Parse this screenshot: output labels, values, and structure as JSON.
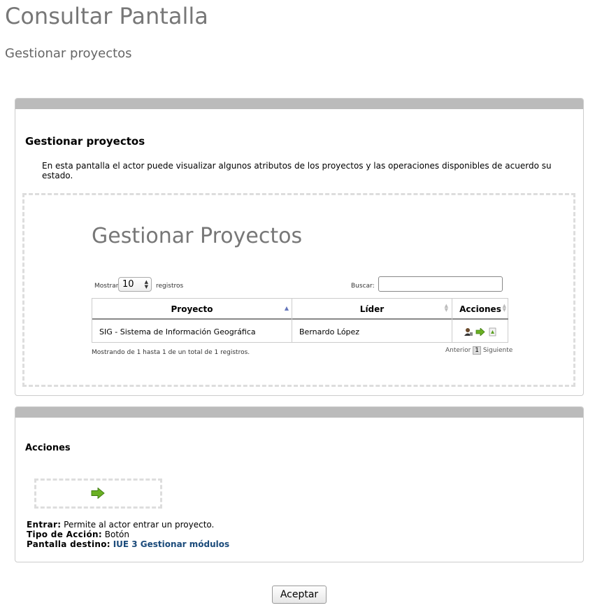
{
  "header": {
    "title": "Consultar Pantalla",
    "subtitle": "Gestionar proyectos"
  },
  "panel1": {
    "title": "Gestionar proyectos",
    "description": "En esta pantalla el actor puede visualizar algunos atributos de los proyectos y las operaciones disponibles de acuerdo su estado.",
    "screen": {
      "title": "Gestionar Proyectos",
      "length_prefix": "Mostrar",
      "length_value": "10",
      "length_suffix": "registros",
      "search_label": "Buscar:",
      "search_value": "",
      "columns": [
        "Proyecto",
        "Líder",
        "Acciones"
      ],
      "rows": [
        {
          "proyecto": "SIG - Sistema de Información Geográfica",
          "lider": "Bernardo López",
          "actions": [
            "user-icon",
            "arrow-right-icon",
            "document-icon"
          ]
        }
      ],
      "info": "Mostrando de 1 hasta 1 de un total de 1 registros.",
      "pagination": {
        "prev": "Anterior",
        "current": "1",
        "next": "Siguiente"
      }
    }
  },
  "panel2": {
    "title": "Acciones",
    "action_icon": "arrow-right-icon",
    "entrar_label": "Entrar:",
    "entrar_text": "Permite al actor entrar un proyecto.",
    "tipo_label": "Tipo de Acción:",
    "tipo_value": "Botón",
    "destino_label": "Pantalla destino:",
    "destino_link": "IUE 3 Gestionar módulos"
  },
  "footer": {
    "accept_label": "Aceptar"
  },
  "colors": {
    "accent_green": "#6ab023",
    "link": "#1a4a7a",
    "panel_header": "#bbbbbb"
  }
}
